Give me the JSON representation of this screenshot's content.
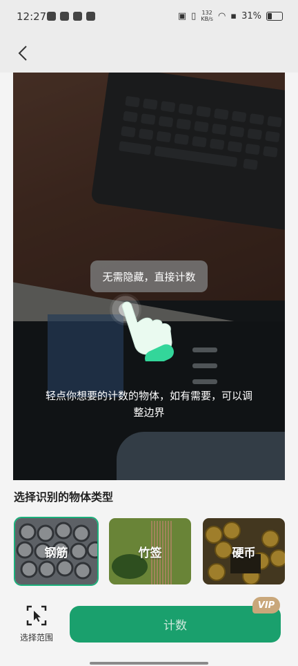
{
  "status_bar": {
    "time": "12:27",
    "net_speed_value": "132",
    "net_speed_unit": "KB/s",
    "battery": "31%"
  },
  "camera": {
    "tip_bubble": "无需隐藏，直接计数",
    "guide_text": "轻点你想要的计数的物体，如有需要，可以调整边界"
  },
  "section_title": "选择识别的物体类型",
  "types": [
    {
      "label": "钢筋",
      "selected": true
    },
    {
      "label": "竹签",
      "selected": false
    },
    {
      "label": "硬币",
      "selected": false
    }
  ],
  "bottom": {
    "select_range_label": "选择范围",
    "count_button": "计数",
    "vip_badge": "VIP"
  },
  "colors": {
    "accent": "#1aa06d",
    "vip": "#c9a77a"
  }
}
